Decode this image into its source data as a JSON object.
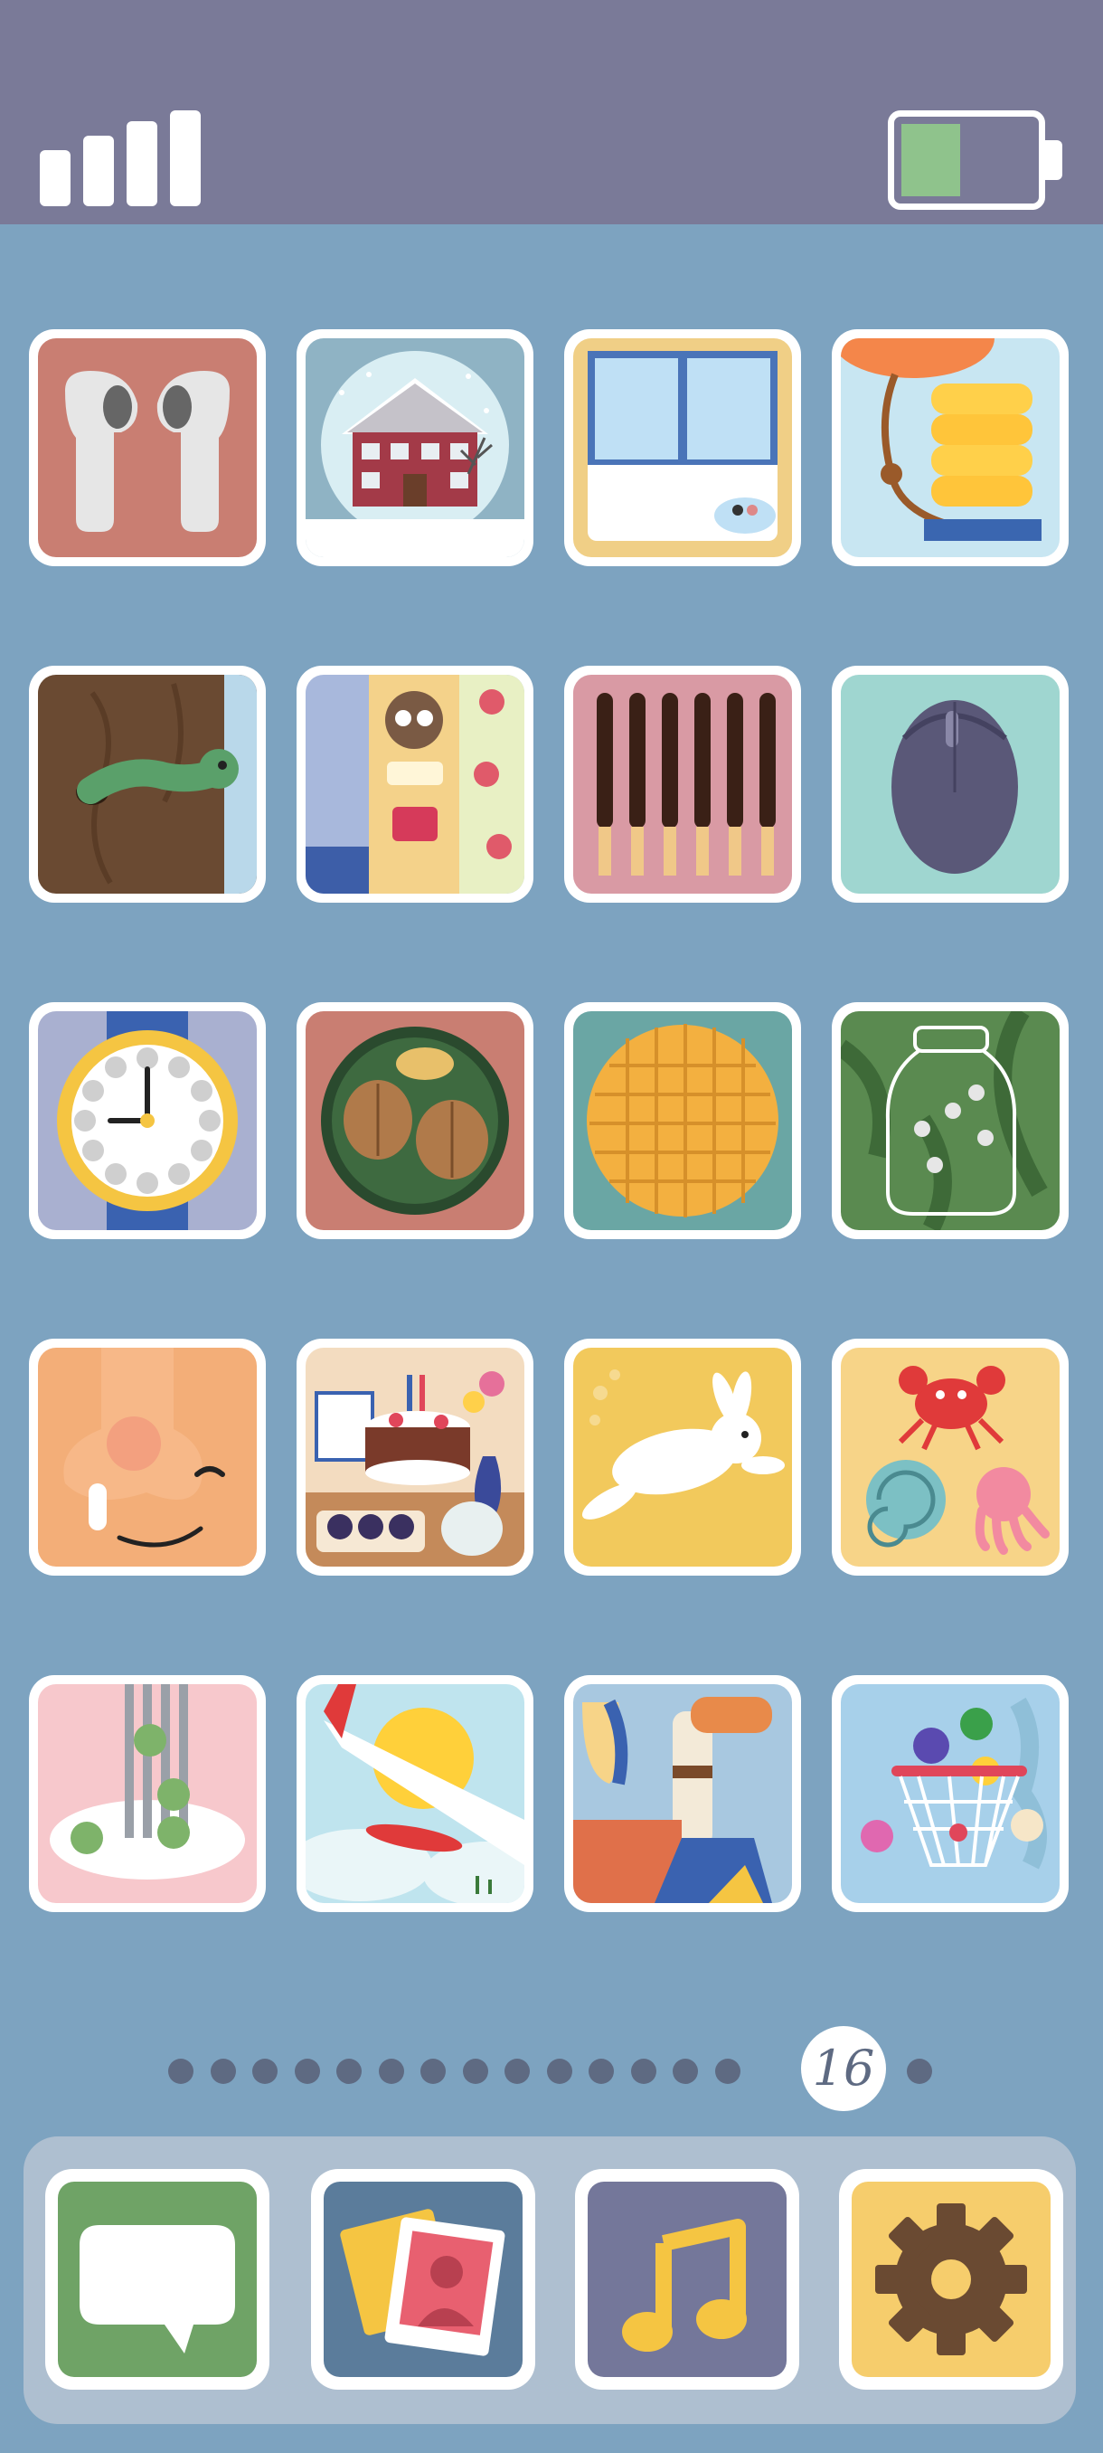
{
  "status_bar": {
    "signal_bars": 4,
    "battery_level": 0.45,
    "colors": {
      "bar": "#7a7a98",
      "battery_fill": "#8fc38c"
    }
  },
  "apps": [
    {
      "name": "earbuds-icon"
    },
    {
      "name": "snow-globe-house-icon"
    },
    {
      "name": "window-icon"
    },
    {
      "name": "balloon-pump-icon"
    },
    {
      "name": "worm-in-wood-icon"
    },
    {
      "name": "cat-strawberry-book-icon"
    },
    {
      "name": "chocolate-sticks-icon"
    },
    {
      "name": "computer-mouse-icon"
    },
    {
      "name": "wristwatch-icon"
    },
    {
      "name": "nuts-plate-icon"
    },
    {
      "name": "waffle-icon"
    },
    {
      "name": "firefly-jar-icon"
    },
    {
      "name": "runny-nose-face-icon"
    },
    {
      "name": "birthday-cake-icon"
    },
    {
      "name": "jumping-rabbit-icon"
    },
    {
      "name": "crab-octopus-shell-icon"
    },
    {
      "name": "fork-peas-icon"
    },
    {
      "name": "airplane-wing-icon"
    },
    {
      "name": "periscope-icon"
    },
    {
      "name": "basketball-hoop-icon"
    }
  ],
  "pager": {
    "total_dots": 16,
    "current_page": "16"
  },
  "dock": [
    {
      "name": "messages-icon",
      "bg": "#6fa366"
    },
    {
      "name": "photos-icon",
      "bg": "#5b7c9b"
    },
    {
      "name": "music-icon",
      "bg": "#74779a"
    },
    {
      "name": "settings-icon",
      "bg": "#f6cd6c"
    }
  ]
}
